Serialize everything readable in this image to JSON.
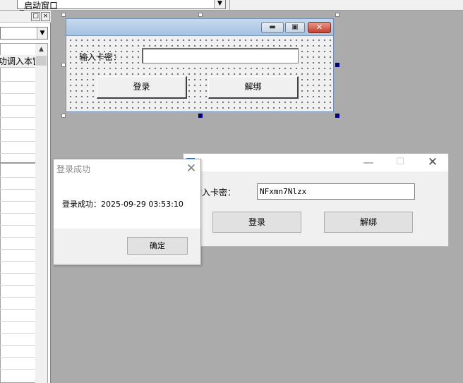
{
  "ide": {
    "window_combo_value": "_启动窗口",
    "property_header": "功调入本窗"
  },
  "design_form": {
    "label_card": "输入卡密：",
    "login_button": "登录",
    "unbind_button": "解绑"
  },
  "runtime_window": {
    "label_card": "输入卡密：",
    "card_value": "NFxmn7Nlzx",
    "login_button": "登录",
    "unbind_button": "解绑"
  },
  "message_box": {
    "title": "登录成功",
    "message": "登录成功：2025-09-29 03:53:10",
    "ok_button": "确定"
  },
  "colors": {
    "workspace": "#ababab",
    "selection_handle": "#000080",
    "title_gradient_top": "#c6d9ef",
    "close_red": "#c4402c"
  }
}
